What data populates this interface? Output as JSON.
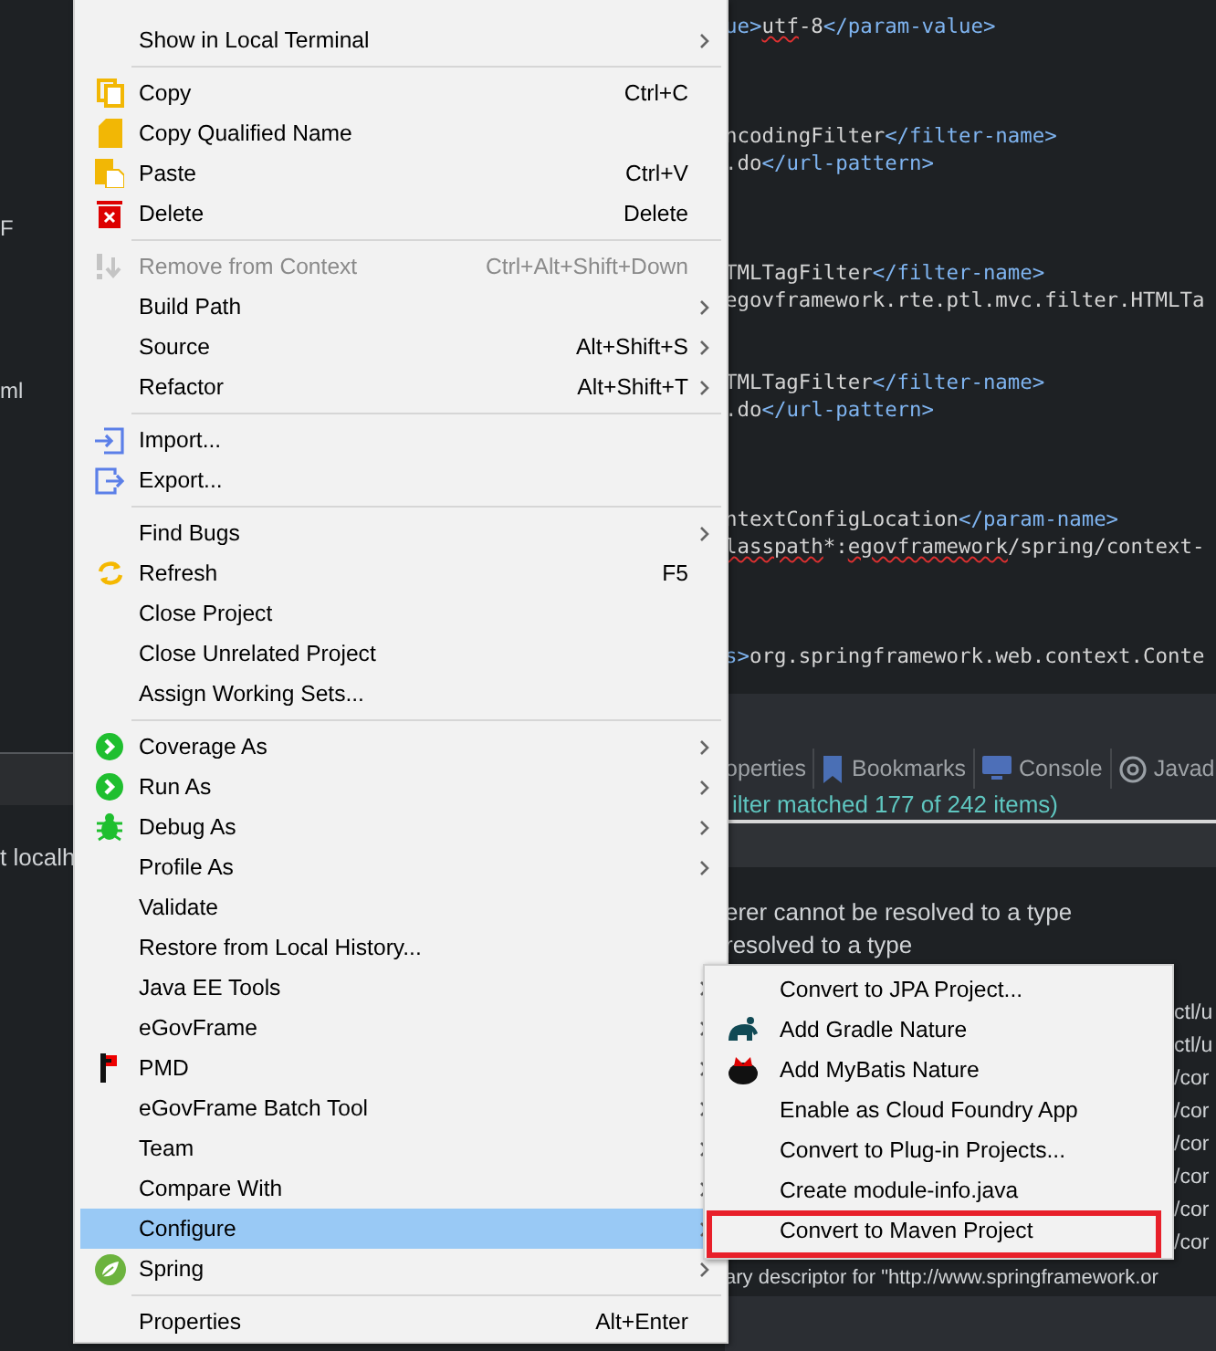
{
  "left_panel": {
    "texts": [
      "F",
      "ml"
    ],
    "console_text": "t localh"
  },
  "editor": {
    "lines": [
      {
        "segments": [
          {
            "text": "ue>",
            "kind": "tag"
          },
          {
            "text": "utf",
            "kind": "misspelled"
          },
          {
            "text": "-8",
            "kind": "text"
          },
          {
            "text": "</param-value>",
            "kind": "tag"
          }
        ]
      },
      {
        "segments": [
          {
            "text": "ncodingFilter",
            "kind": "text"
          },
          {
            "text": "</filter-name>",
            "kind": "tag"
          }
        ]
      },
      {
        "segments": [
          {
            "text": ".do",
            "kind": "text"
          },
          {
            "text": "</url-pattern>",
            "kind": "tag"
          }
        ]
      },
      {
        "segments": [
          {
            "text": "TMLTagFilter",
            "kind": "text"
          },
          {
            "text": "</filter-name>",
            "kind": "tag"
          }
        ]
      },
      {
        "segments": [
          {
            "text": "egovframework.rte.ptl.mvc.filter.HTMLTa",
            "kind": "text"
          }
        ]
      },
      {
        "segments": [
          {
            "text": "TMLTagFilter",
            "kind": "text"
          },
          {
            "text": "</filter-name>",
            "kind": "tag"
          }
        ]
      },
      {
        "segments": [
          {
            "text": ".do",
            "kind": "text"
          },
          {
            "text": "</url-pattern>",
            "kind": "tag"
          }
        ]
      },
      {
        "segments": [
          {
            "text": "ntextConfigLocation",
            "kind": "text"
          },
          {
            "text": "</param-name>",
            "kind": "tag"
          }
        ]
      },
      {
        "segments": [
          {
            "text": "lasspath",
            "kind": "misspelled"
          },
          {
            "text": "*:",
            "kind": "text"
          },
          {
            "text": "egovframework",
            "kind": "misspelled"
          },
          {
            "text": "/spring/context-",
            "kind": "text"
          }
        ]
      },
      {
        "segments": [
          {
            "text": "s>",
            "kind": "tag"
          },
          {
            "text": "org.springframework.web.context.Conte",
            "kind": "text"
          }
        ]
      }
    ]
  },
  "bottom_panel": {
    "tabs": [
      {
        "label": "operties",
        "selected": false
      },
      {
        "label": "Bookmarks",
        "selected": false
      },
      {
        "label": "Console",
        "selected": false
      },
      {
        "label": "Javad",
        "selected": false
      }
    ],
    "filter_status": "ilter matched 177 of 242 items)",
    "problems": [
      "erer cannot be resolved to a type",
      "resolved to a type"
    ],
    "paths": [
      "ctl/u",
      "ctl/u",
      "/cor",
      "/cor",
      "/cor",
      "/cor",
      "/cor",
      "/cor"
    ],
    "last_line": "ary descriptor for \"http://www.springframework.or"
  },
  "context_menu": {
    "groups": [
      [
        {
          "label": "Show in Local Terminal",
          "submenu": true,
          "disabled": false,
          "selected": false
        }
      ],
      [
        {
          "label": "Copy",
          "shortcut": "Ctrl+C",
          "submenu": false,
          "disabled": false,
          "selected": false
        },
        {
          "label": "Copy Qualified Name",
          "submenu": false,
          "disabled": false,
          "selected": false
        },
        {
          "label": "Paste",
          "shortcut": "Ctrl+V",
          "submenu": false,
          "disabled": false,
          "selected": false
        },
        {
          "label": "Delete",
          "shortcut": "Delete",
          "submenu": false,
          "disabled": false,
          "selected": false
        }
      ],
      [
        {
          "label": "Remove from Context",
          "shortcut": "Ctrl+Alt+Shift+Down",
          "submenu": false,
          "disabled": true,
          "selected": false
        },
        {
          "label": "Build Path",
          "submenu": true,
          "disabled": false,
          "selected": false
        },
        {
          "label": "Source",
          "shortcut": "Alt+Shift+S",
          "submenu": true,
          "disabled": false,
          "selected": false
        },
        {
          "label": "Refactor",
          "shortcut": "Alt+Shift+T",
          "submenu": true,
          "disabled": false,
          "selected": false
        }
      ],
      [
        {
          "label": "Import...",
          "submenu": false,
          "disabled": false,
          "selected": false
        },
        {
          "label": "Export...",
          "submenu": false,
          "disabled": false,
          "selected": false
        }
      ],
      [
        {
          "label": "Find Bugs",
          "submenu": true,
          "disabled": false,
          "selected": false
        },
        {
          "label": "Refresh",
          "shortcut": "F5",
          "submenu": false,
          "disabled": false,
          "selected": false
        },
        {
          "label": "Close Project",
          "submenu": false,
          "disabled": false,
          "selected": false
        },
        {
          "label": "Close Unrelated Project",
          "submenu": false,
          "disabled": false,
          "selected": false
        },
        {
          "label": "Assign Working Sets...",
          "submenu": false,
          "disabled": false,
          "selected": false
        }
      ],
      [
        {
          "label": "Coverage As",
          "submenu": true,
          "disabled": false,
          "selected": false
        },
        {
          "label": "Run As",
          "submenu": true,
          "disabled": false,
          "selected": false
        },
        {
          "label": "Debug As",
          "submenu": true,
          "disabled": false,
          "selected": false
        },
        {
          "label": "Profile As",
          "submenu": true,
          "disabled": false,
          "selected": false
        },
        {
          "label": "Validate",
          "submenu": false,
          "disabled": false,
          "selected": false
        },
        {
          "label": "Restore from Local History...",
          "submenu": false,
          "disabled": false,
          "selected": false
        },
        {
          "label": "Java EE Tools",
          "submenu": true,
          "disabled": false,
          "selected": false
        },
        {
          "label": "eGovFrame",
          "submenu": true,
          "disabled": false,
          "selected": false
        },
        {
          "label": "PMD",
          "submenu": true,
          "disabled": false,
          "selected": false
        },
        {
          "label": "eGovFrame Batch Tool",
          "submenu": true,
          "disabled": false,
          "selected": false
        },
        {
          "label": "Team",
          "submenu": true,
          "disabled": false,
          "selected": false
        },
        {
          "label": "Compare With",
          "submenu": true,
          "disabled": false,
          "selected": false
        },
        {
          "label": "Configure",
          "submenu": true,
          "disabled": false,
          "selected": true
        },
        {
          "label": "Spring",
          "submenu": true,
          "disabled": false,
          "selected": false
        }
      ],
      [
        {
          "label": "Properties",
          "shortcut": "Alt+Enter",
          "submenu": false,
          "disabled": false,
          "selected": false
        }
      ]
    ]
  },
  "configure_submenu": {
    "items": [
      {
        "label": "Convert to JPA Project...",
        "selected": false,
        "annotated": false
      },
      {
        "label": "Add Gradle Nature",
        "selected": false,
        "annotated": false
      },
      {
        "label": "Add MyBatis Nature",
        "selected": false,
        "annotated": false
      },
      {
        "label": "Enable as Cloud Foundry App",
        "selected": false,
        "annotated": false
      },
      {
        "label": "Convert to Plug-in Projects...",
        "selected": false,
        "annotated": false
      },
      {
        "label": "Create module-info.java",
        "selected": false,
        "annotated": false
      },
      {
        "label": "Convert to Maven Project",
        "selected": false,
        "annotated": true
      }
    ]
  }
}
